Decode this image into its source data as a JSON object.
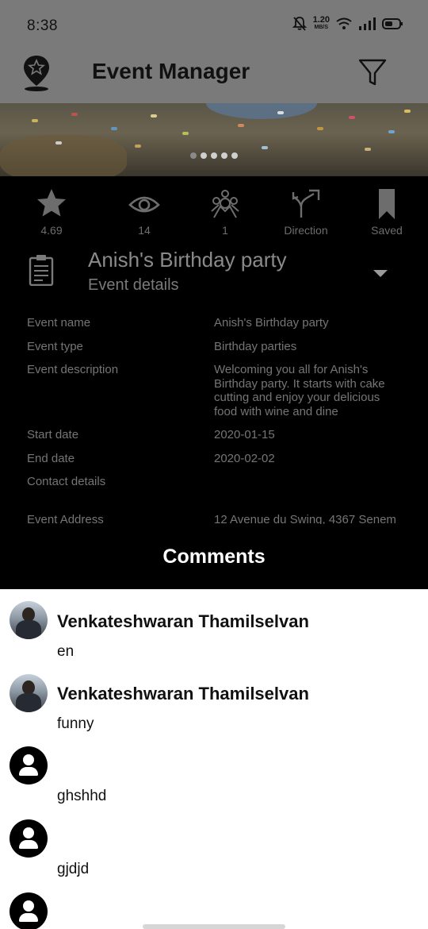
{
  "status_bar": {
    "time": "8:38",
    "net_speed_value": "1.20",
    "net_speed_unit": "MB/S"
  },
  "app_bar": {
    "title": "Event Manager"
  },
  "stats": [
    {
      "label": "4.69",
      "icon": "star-icon"
    },
    {
      "label": "14",
      "icon": "eye-icon"
    },
    {
      "label": "1",
      "icon": "people-icon"
    },
    {
      "label": "Direction",
      "icon": "direction-icon"
    },
    {
      "label": "Saved",
      "icon": "bookmark-icon"
    }
  ],
  "event": {
    "title": "Anish's Birthday party",
    "subtitle": "Event details"
  },
  "details": [
    {
      "key": "Event name",
      "value": "Anish's Birthday party"
    },
    {
      "key": "Event type",
      "value": "Birthday parties"
    },
    {
      "key": "Event description",
      "value": "Welcoming you all for Anish's Birthday party. It starts with cake cutting and enjoy your delicious food with wine and dine"
    },
    {
      "key": "Start date",
      "value": "2020-01-15"
    },
    {
      "key": "End date",
      "value": "2020-02-02"
    },
    {
      "key": "Contact details",
      "value": ""
    },
    {
      "key": "Event Address",
      "value": "12 Avenue du Swing, 4367 Senem"
    }
  ],
  "comments_title": "Comments",
  "comments": [
    {
      "name": "Venkateshwaran Thamilselvan",
      "text": "en"
    },
    {
      "name": "Venkateshwaran Thamilselvan",
      "text": "funny"
    },
    {
      "name": "",
      "text": "ghshhd"
    },
    {
      "name": "",
      "text": "gjdjd"
    },
    {
      "name": "",
      "text": ""
    }
  ]
}
